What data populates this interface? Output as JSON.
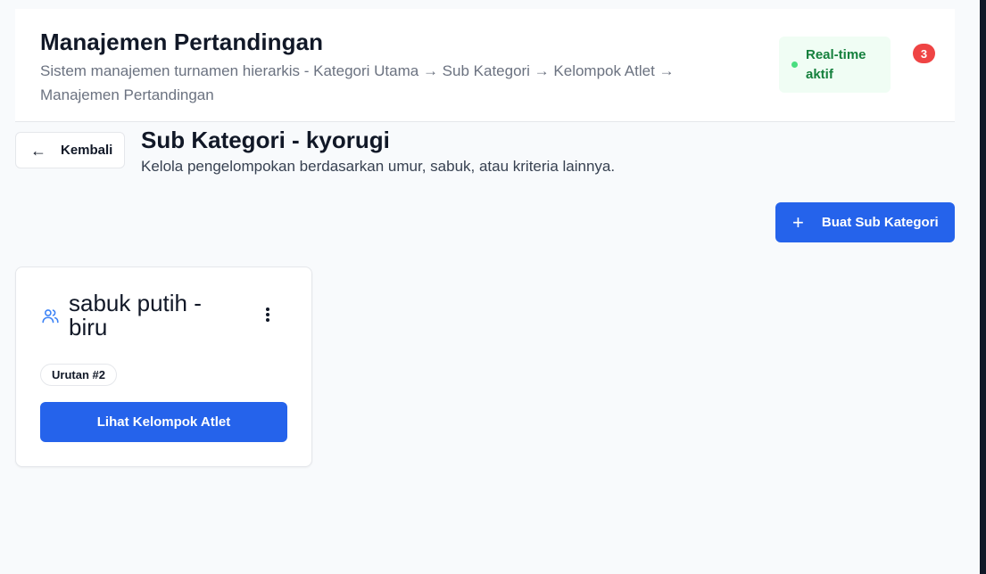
{
  "header": {
    "title": "Manajemen Pertandingan",
    "subtitle": "Sistem manajemen turnamen hierarkis - Kategori Utama → Sub Kategori → Kelompok Atlet → Manajemen Pertandingan",
    "realtime_label": "Real-time aktif",
    "realtime_color": "#15803d",
    "notification_count": "3"
  },
  "nav": {
    "back_label": "Kembali",
    "back_icon": "arrow-left-icon"
  },
  "section": {
    "title": "Sub Kategori - kyorugi",
    "subtitle": "Kelola pengelompokan berdasarkan umur, sabuk, atau kriteria lainnya.",
    "create_label": "Buat Sub Kategori",
    "create_icon": "plus-icon"
  },
  "cards": [
    {
      "icon": "users-icon",
      "title": "sabuk putih - biru",
      "order_badge": "Urutan #2",
      "action_label": "Lihat Kelompok Atlet",
      "menu_icon": "more-vertical-icon"
    }
  ],
  "colors": {
    "primary": "#2563eb",
    "danger": "#ef4444",
    "success_bg": "#f0fdf4"
  }
}
